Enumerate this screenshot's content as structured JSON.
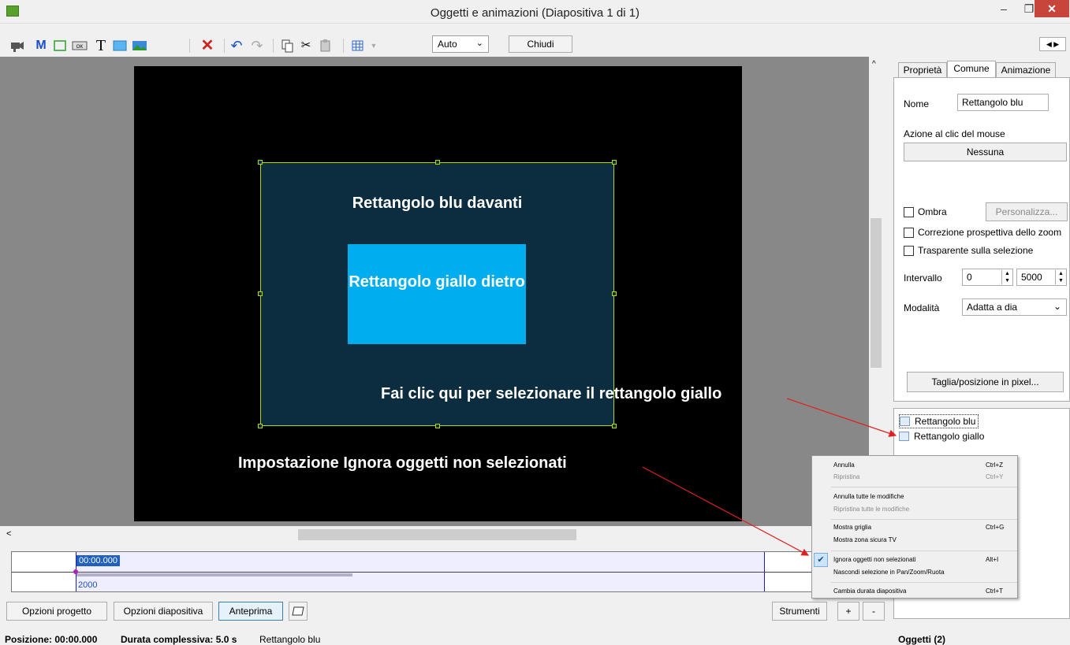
{
  "window": {
    "title": "Oggetti e animazioni  (Diapositiva 1 di 1)",
    "minimize_glyph": "–",
    "maximize_glyph": "❐",
    "close_glyph": "✕"
  },
  "toolbar": {
    "icons": [
      "camera-icon",
      "m-letter-icon",
      "rectangle-frame-icon",
      "ok-button-icon",
      "text-icon",
      "blue-rectangle-icon",
      "image-icon",
      "delete-icon",
      "undo-icon",
      "redo-icon",
      "copy-icon",
      "cut-icon",
      "paste-icon",
      "grid-icon"
    ],
    "m_label": "M",
    "t_label": "T",
    "ok_label": "OK",
    "zoom_select": "Auto",
    "close_button": "Chiudi"
  },
  "slide": {
    "blue_rect_text": "Rettangolo blu davanti",
    "yellow_rect_text": "Rettangolo giallo dietro",
    "annotation_1": "Fai clic qui per selezionare il rettangolo giallo",
    "annotation_2": "Impostazione Ignora oggetti non selezionati",
    "colors": {
      "blue_rect": "#0c2d3f",
      "yellow_rect": "#00adef",
      "selection": "#b5d800",
      "arrow": "#e02020"
    }
  },
  "timeline": {
    "time": "00:00.000",
    "duration_marker": "2000"
  },
  "bottom_buttons": {
    "project_options": "Opzioni progetto",
    "slide_options": "Opzioni diapositiva",
    "preview": "Anteprima",
    "tools": "Strumenti",
    "plus": "+",
    "minus": "-"
  },
  "statusbar": {
    "position": "Posizione: 00:00.000",
    "total_duration": "Durata complessiva: 5.0 s",
    "selected": "Rettangolo blu",
    "objects": "Oggetti (2)"
  },
  "properties": {
    "tabs": [
      "Proprietà",
      "Comune",
      "Animazione"
    ],
    "active_tab": "Comune",
    "name_label": "Nome",
    "name_value": "Rettangolo blu",
    "click_action_label": "Azione al clic del mouse",
    "click_action_value": "Nessuna",
    "shadow_label": "Ombra",
    "customize_button": "Personalizza...",
    "zoom_perspective_label": "Correzione prospettiva dello zoom",
    "transparent_label": "Trasparente sulla selezione",
    "interval_label": "Intervallo",
    "interval_start": "0",
    "interval_end": "5000",
    "mode_label": "Modalità",
    "mode_value": "Adatta a dia",
    "crop_button": "Taglia/posizione in pixel..."
  },
  "object_list": [
    "Rettangolo blu",
    "Rettangolo giallo"
  ],
  "context_menu": [
    {
      "label": "Annulla",
      "shortcut": "Ctrl+Z",
      "disabled": false
    },
    {
      "label": "Ripristina",
      "shortcut": "Ctrl+Y",
      "disabled": true
    },
    {
      "label": "Annulla tutte le modifiche",
      "shortcut": "",
      "disabled": false
    },
    {
      "label": "Ripristina tutte le modifiche",
      "shortcut": "",
      "disabled": true
    },
    {
      "label": "Mostra griglia",
      "shortcut": "Ctrl+G",
      "disabled": false
    },
    {
      "label": "Mostra zona sicura TV",
      "shortcut": "",
      "disabled": false
    },
    {
      "label": "Ignora oggetti non selezionati",
      "shortcut": "Alt+I",
      "disabled": false,
      "checked": true
    },
    {
      "label": "Nascondi selezione in Pan/Zoom/Ruota",
      "shortcut": "",
      "disabled": false
    },
    {
      "label": "Cambia durata diapositiva",
      "shortcut": "Ctrl+T",
      "disabled": false
    }
  ]
}
